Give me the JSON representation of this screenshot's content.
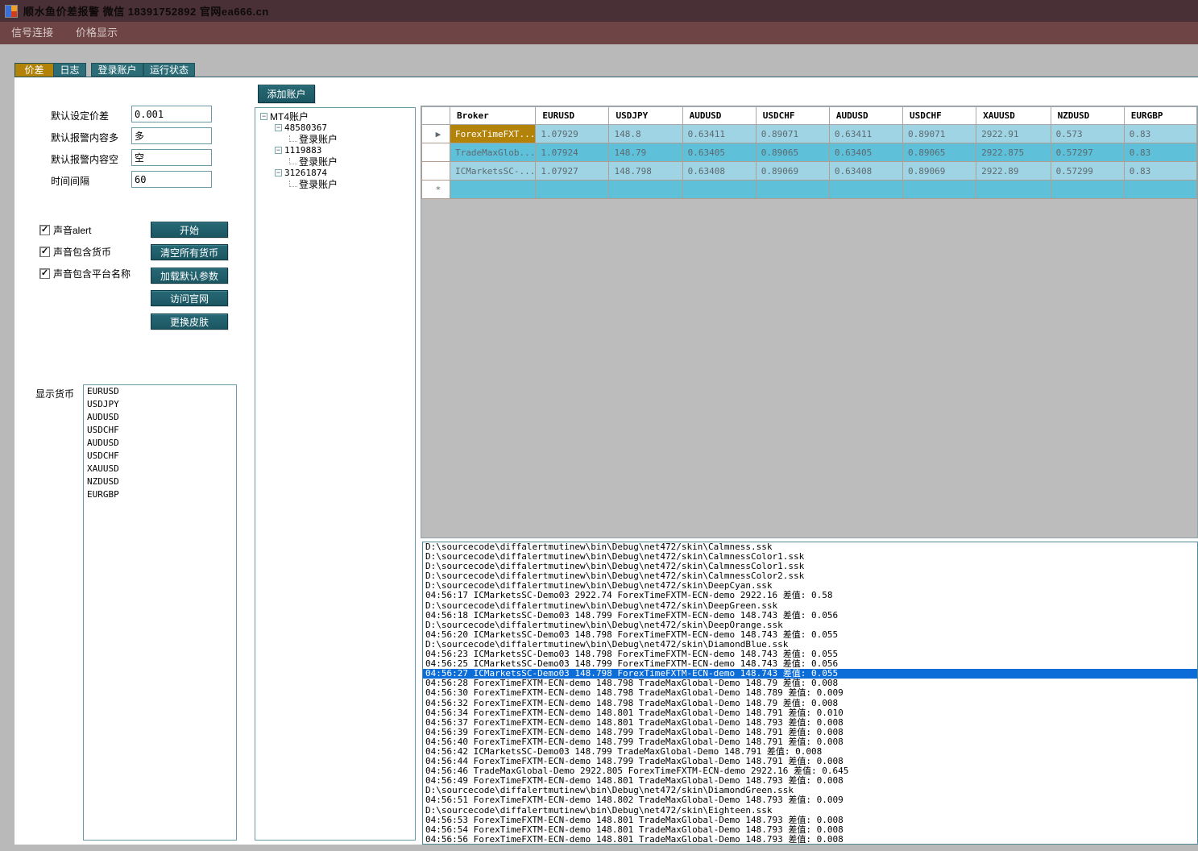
{
  "window": {
    "title": "顺水鱼价差报警  微信  18391752892  官网ea666.cn"
  },
  "menu": {
    "items": [
      "信号连接",
      "价格显示"
    ]
  },
  "tabs": [
    {
      "label": "价差",
      "active": true
    },
    {
      "label": "日志",
      "active": false
    },
    {
      "label": "登录账户",
      "active": false
    },
    {
      "label": "运行状态",
      "active": false
    }
  ],
  "settings": {
    "fields": [
      {
        "key": "default-diff",
        "label": "默认设定价差",
        "value": "0.001"
      },
      {
        "key": "alert-content-long",
        "label": "默认报警内容多",
        "value": "多"
      },
      {
        "key": "alert-content-short",
        "label": "默认报警内容空",
        "value": "空"
      },
      {
        "key": "interval",
        "label": "时间间隔",
        "value": "60"
      }
    ],
    "checkboxes": [
      {
        "key": "sound-alert",
        "label": "声音alert",
        "checked": true
      },
      {
        "key": "sound-currency",
        "label": "声音包含货币",
        "checked": true
      },
      {
        "key": "sound-platform",
        "label": "声音包含平台名称",
        "checked": true
      }
    ],
    "buttons": [
      {
        "key": "start",
        "label": "开始"
      },
      {
        "key": "clear-all",
        "label": "清空所有货币"
      },
      {
        "key": "load-default",
        "label": "加载默认参数"
      },
      {
        "key": "visit-site",
        "label": "访问官网"
      },
      {
        "key": "change-skin",
        "label": "更换皮肤"
      }
    ]
  },
  "currency_panel": {
    "label": "显示货币",
    "items": [
      "EURUSD",
      "USDJPY",
      "AUDUSD",
      "USDCHF",
      "AUDUSD",
      "USDCHF",
      "XAUUSD",
      "NZDUSD",
      "EURGBP"
    ]
  },
  "accounts": {
    "add_button": "添加账户",
    "root": "MT4账户",
    "login_label": "登录账户",
    "children": [
      "48580367",
      "1119883",
      "31261874"
    ]
  },
  "grid": {
    "columns": [
      "Broker",
      "EURUSD",
      "USDJPY",
      "AUDUSD",
      "USDCHF",
      "AUDUSD",
      "USDCHF",
      "XAUUSD",
      "NZDUSD",
      "EURGBP"
    ],
    "rows": [
      {
        "broker": "ForexTimeFXT...",
        "selected": true,
        "values": [
          "1.07929",
          "148.8",
          "0.63411",
          "0.89071",
          "0.63411",
          "0.89071",
          "2922.91",
          "0.573",
          "0.83"
        ]
      },
      {
        "broker": "TradeMaxGlob...",
        "selected": false,
        "values": [
          "1.07924",
          "148.79",
          "0.63405",
          "0.89065",
          "0.63405",
          "0.89065",
          "2922.875",
          "0.57297",
          "0.83"
        ]
      },
      {
        "broker": "ICMarketsSC-...",
        "selected": false,
        "values": [
          "1.07927",
          "148.798",
          "0.63408",
          "0.89069",
          "0.63408",
          "0.89069",
          "2922.89",
          "0.57299",
          "0.83"
        ]
      }
    ],
    "new_row_symbol": "*",
    "current_row_arrow": "▶"
  },
  "log": {
    "selected_index": 13,
    "lines": [
      "D:\\sourcecode\\diffalertmutinew\\bin\\Debug\\net472/skin\\Calmness.ssk",
      "D:\\sourcecode\\diffalertmutinew\\bin\\Debug\\net472/skin\\CalmnessColor1.ssk",
      "D:\\sourcecode\\diffalertmutinew\\bin\\Debug\\net472/skin\\CalmnessColor1.ssk",
      "D:\\sourcecode\\diffalertmutinew\\bin\\Debug\\net472/skin\\CalmnessColor2.ssk",
      "D:\\sourcecode\\diffalertmutinew\\bin\\Debug\\net472/skin\\DeepCyan.ssk",
      "04:56:17 ICMarketsSC-Demo03 2922.74 ForexTimeFXTM-ECN-demo 2922.16 差值: 0.58",
      "D:\\sourcecode\\diffalertmutinew\\bin\\Debug\\net472/skin\\DeepGreen.ssk",
      "04:56:18 ICMarketsSC-Demo03 148.799 ForexTimeFXTM-ECN-demo 148.743 差值: 0.056",
      "D:\\sourcecode\\diffalertmutinew\\bin\\Debug\\net472/skin\\DeepOrange.ssk",
      "04:56:20 ICMarketsSC-Demo03 148.798 ForexTimeFXTM-ECN-demo 148.743 差值: 0.055",
      "D:\\sourcecode\\diffalertmutinew\\bin\\Debug\\net472/skin\\DiamondBlue.ssk",
      "04:56:23 ICMarketsSC-Demo03 148.798 ForexTimeFXTM-ECN-demo 148.743 差值: 0.055",
      "04:56:25 ICMarketsSC-Demo03 148.799 ForexTimeFXTM-ECN-demo 148.743 差值: 0.056",
      "04:56:27 ICMarketsSC-Demo03 148.798 ForexTimeFXTM-ECN-demo 148.743 差值: 0.055",
      "04:56:28 ForexTimeFXTM-ECN-demo 148.798 TradeMaxGlobal-Demo 148.79 差值: 0.008",
      "04:56:30 ForexTimeFXTM-ECN-demo 148.798 TradeMaxGlobal-Demo 148.789 差值: 0.009",
      "04:56:32 ForexTimeFXTM-ECN-demo 148.798 TradeMaxGlobal-Demo 148.79 差值: 0.008",
      "04:56:34 ForexTimeFXTM-ECN-demo 148.801 TradeMaxGlobal-Demo 148.791 差值: 0.010",
      "04:56:37 ForexTimeFXTM-ECN-demo 148.801 TradeMaxGlobal-Demo 148.793 差值: 0.008",
      "04:56:39 ForexTimeFXTM-ECN-demo 148.799 TradeMaxGlobal-Demo 148.791 差值: 0.008",
      "04:56:40 ForexTimeFXTM-ECN-demo 148.799 TradeMaxGlobal-Demo 148.791 差值: 0.008",
      "04:56:42 ICMarketsSC-Demo03 148.799 TradeMaxGlobal-Demo 148.791 差值: 0.008",
      "04:56:44 ForexTimeFXTM-ECN-demo 148.799 TradeMaxGlobal-Demo 148.791 差值: 0.008",
      "04:56:46 TradeMaxGlobal-Demo 2922.805 ForexTimeFXTM-ECN-demo 2922.16 差值: 0.645",
      "04:56:49 ForexTimeFXTM-ECN-demo 148.801 TradeMaxGlobal-Demo 148.793 差值: 0.008",
      "D:\\sourcecode\\diffalertmutinew\\bin\\Debug\\net472/skin\\DiamondGreen.ssk",
      "04:56:51 ForexTimeFXTM-ECN-demo 148.802 TradeMaxGlobal-Demo 148.793 差值: 0.009",
      "D:\\sourcecode\\diffalertmutinew\\bin\\Debug\\net472/skin\\Eighteen.ssk",
      "04:56:53 ForexTimeFXTM-ECN-demo 148.801 TradeMaxGlobal-Demo 148.793 差值: 0.008",
      "04:56:54 ForexTimeFXTM-ECN-demo 148.801 TradeMaxGlobal-Demo 148.793 差值: 0.008",
      "04:56:56 ForexTimeFXTM-ECN-demo 148.801 TradeMaxGlobal-Demo 148.793 差值: 0.008"
    ]
  }
}
